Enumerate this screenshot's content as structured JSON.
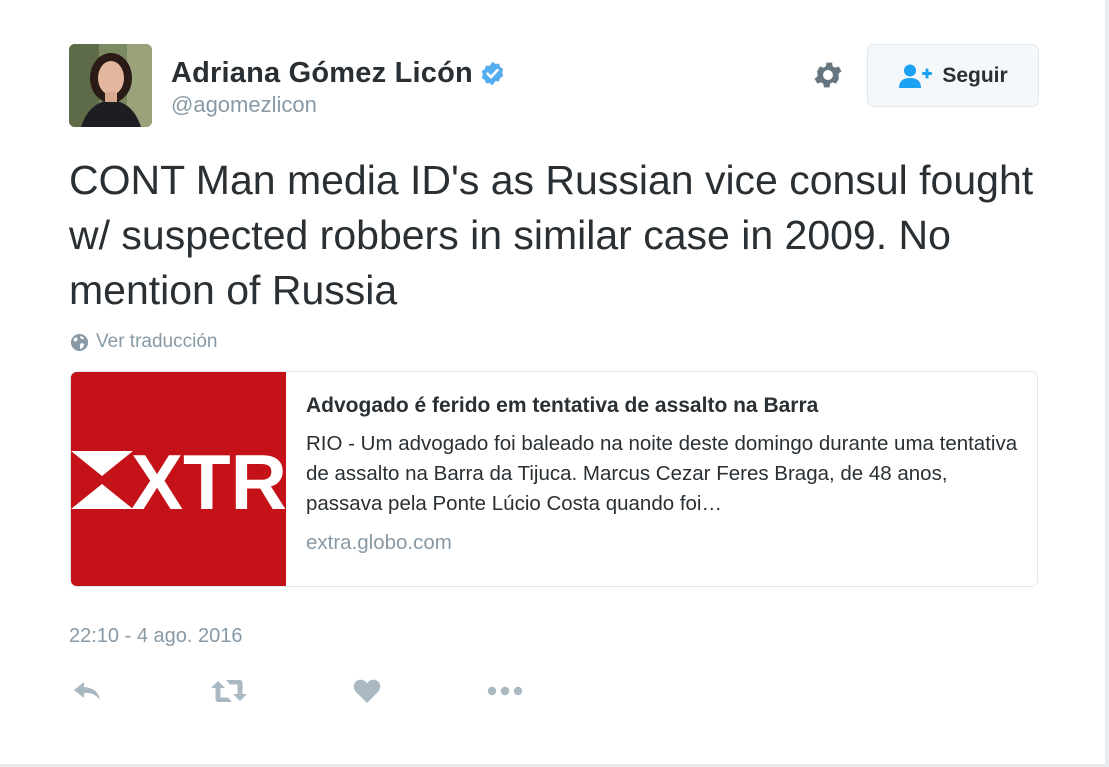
{
  "author": {
    "name": "Adriana Gómez Licón",
    "handle": "@agomezlicon",
    "verified": true
  },
  "header": {
    "settings_icon": "gear-icon",
    "follow_label": "Seguir",
    "follow_icon": "add-person-icon"
  },
  "tweet": {
    "text": "CONT Man media ID's as Russian vice consul fought w/ suspected robbers in similar case in 2009. No mention of Russia",
    "translate_label": "Ver traducción",
    "timestamp": "22:10 - 4 ago. 2016"
  },
  "card": {
    "image_text": "XTRA",
    "title": "Advogado é ferido em tentativa de assalto na Barra",
    "description": "RIO - Um advogado foi baleado na noite deste domingo durante uma tentativa de assalto na Barra da Tijuca. Marcus Cezar Feres Braga, de 48 anos, passava pela Ponte Lúcio Costa quando foi…",
    "domain": "extra.globo.com"
  },
  "actions": [
    "reply-icon",
    "retweet-icon",
    "like-icon",
    "more-icon"
  ],
  "colors": {
    "text": "#292f33",
    "muted": "#8899a6",
    "verified": "#55acee",
    "follow_icon": "#1da1f2",
    "card_image": "#c41218",
    "action_icon": "#aab8c2",
    "border": "#e1e8ed"
  }
}
